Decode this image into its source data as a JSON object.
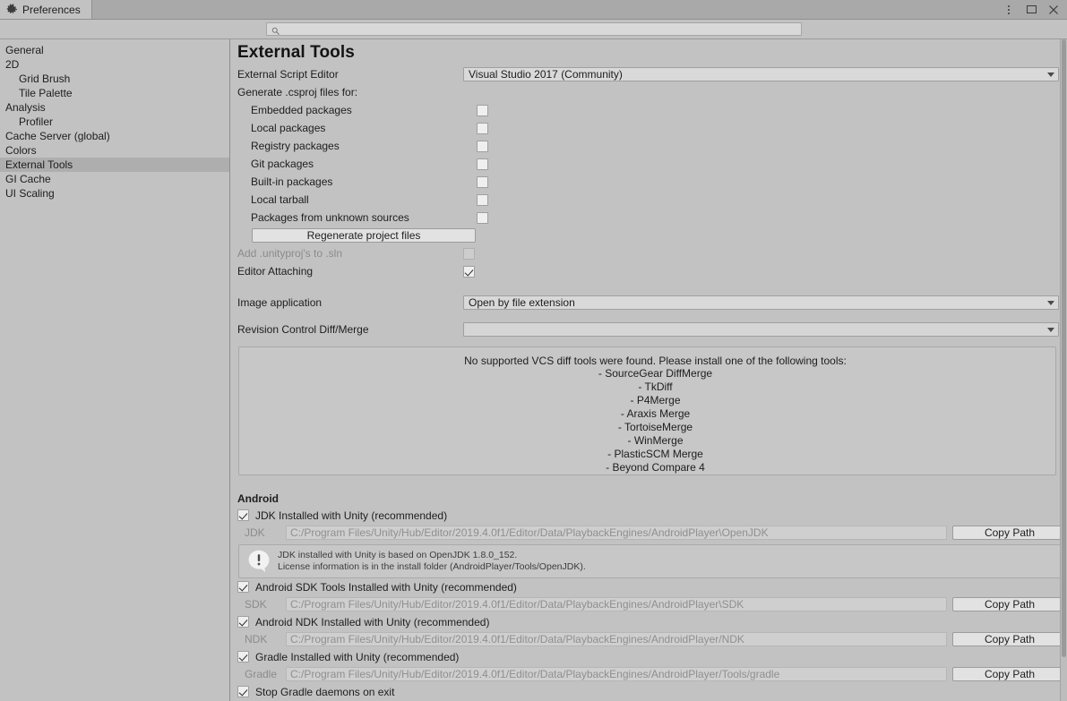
{
  "window": {
    "tab_label": "Preferences",
    "tab_icon": "gear-icon",
    "menu_icon": "vertical-dots-icon",
    "maximize_icon": "maximize-icon",
    "close_icon": "close-icon",
    "close_glyph": "✕"
  },
  "search": {
    "value": "",
    "placeholder": "",
    "icon": "search-icon"
  },
  "sidebar": {
    "items": [
      {
        "label": "General",
        "indent": false,
        "selected": false
      },
      {
        "label": "2D",
        "indent": false,
        "selected": false
      },
      {
        "label": "Grid Brush",
        "indent": true,
        "selected": false
      },
      {
        "label": "Tile Palette",
        "indent": true,
        "selected": false
      },
      {
        "label": "Analysis",
        "indent": false,
        "selected": false
      },
      {
        "label": "Profiler",
        "indent": true,
        "selected": false
      },
      {
        "label": "Cache Server (global)",
        "indent": false,
        "selected": false
      },
      {
        "label": "Colors",
        "indent": false,
        "selected": false
      },
      {
        "label": "External Tools",
        "indent": false,
        "selected": true
      },
      {
        "label": "GI Cache",
        "indent": false,
        "selected": false
      },
      {
        "label": "UI Scaling",
        "indent": false,
        "selected": false
      }
    ]
  },
  "main": {
    "title": "External Tools",
    "script_editor": {
      "label": "External Script Editor",
      "value": "Visual Studio 2017 (Community)"
    },
    "csproj": {
      "label": "Generate .csproj files for:",
      "options": [
        {
          "label": "Embedded packages",
          "checked": false,
          "disabled": false
        },
        {
          "label": "Local packages",
          "checked": false,
          "disabled": false
        },
        {
          "label": "Registry packages",
          "checked": false,
          "disabled": false
        },
        {
          "label": "Git packages",
          "checked": false,
          "disabled": false
        },
        {
          "label": "Built-in packages",
          "checked": false,
          "disabled": false
        },
        {
          "label": "Local tarball",
          "checked": false,
          "disabled": false
        },
        {
          "label": "Packages from unknown sources",
          "checked": false,
          "disabled": false
        }
      ],
      "regenerate_button": "Regenerate project files"
    },
    "add_unityproj": {
      "label": "Add .unityproj's to .sln",
      "checked": false,
      "disabled": true
    },
    "editor_attaching": {
      "label": "Editor Attaching",
      "checked": true,
      "disabled": false
    },
    "image_application": {
      "label": "Image application",
      "value": "Open by file extension"
    },
    "revision_control": {
      "label": "Revision Control Diff/Merge",
      "value": ""
    },
    "vcs_help": {
      "title": "No supported VCS diff tools were found. Please install one of the following tools:",
      "tools": [
        "- SourceGear DiffMerge",
        "- TkDiff",
        "- P4Merge",
        "- Araxis Merge",
        "- TortoiseMerge",
        "- WinMerge",
        "- PlasticSCM Merge",
        "- Beyond Compare 4"
      ]
    },
    "android": {
      "heading": "Android",
      "jdk": {
        "checkbox_label": "JDK Installed with Unity (recommended)",
        "checked": true,
        "field_label": "JDK",
        "path": "C:/Program Files/Unity/Hub/Editor/2019.4.0f1/Editor/Data/PlaybackEngines/AndroidPlayer\\OpenJDK",
        "copy_button": "Copy Path",
        "info_icon": "warning-icon",
        "info_line1": "JDK installed with Unity is based on OpenJDK 1.8.0_152.",
        "info_line2": "License information is in the install folder (AndroidPlayer/Tools/OpenJDK)."
      },
      "sdk": {
        "checkbox_label": "Android SDK Tools Installed with Unity (recommended)",
        "checked": true,
        "field_label": "SDK",
        "path": "C:/Program Files/Unity/Hub/Editor/2019.4.0f1/Editor/Data/PlaybackEngines/AndroidPlayer\\SDK",
        "copy_button": "Copy Path"
      },
      "ndk": {
        "checkbox_label": "Android NDK Installed with Unity (recommended)",
        "checked": true,
        "field_label": "NDK",
        "path": "C:/Program Files/Unity/Hub/Editor/2019.4.0f1/Editor/Data/PlaybackEngines/AndroidPlayer/NDK",
        "copy_button": "Copy Path"
      },
      "gradle": {
        "checkbox_label": "Gradle Installed with Unity (recommended)",
        "checked": true,
        "field_label": "Gradle",
        "path": "C:/Program Files/Unity/Hub/Editor/2019.4.0f1/Editor/Data/PlaybackEngines/AndroidPlayer/Tools/gradle",
        "copy_button": "Copy Path"
      },
      "stop_gradle": {
        "label": "Stop Gradle daemons on exit",
        "checked": true
      }
    }
  },
  "colors": {
    "background": "#c2c2c2",
    "titlebar": "#a9a9a9",
    "selection": "#aeaeae",
    "field": "#d9d9d9",
    "disabled_text": "#8b8b8b"
  }
}
